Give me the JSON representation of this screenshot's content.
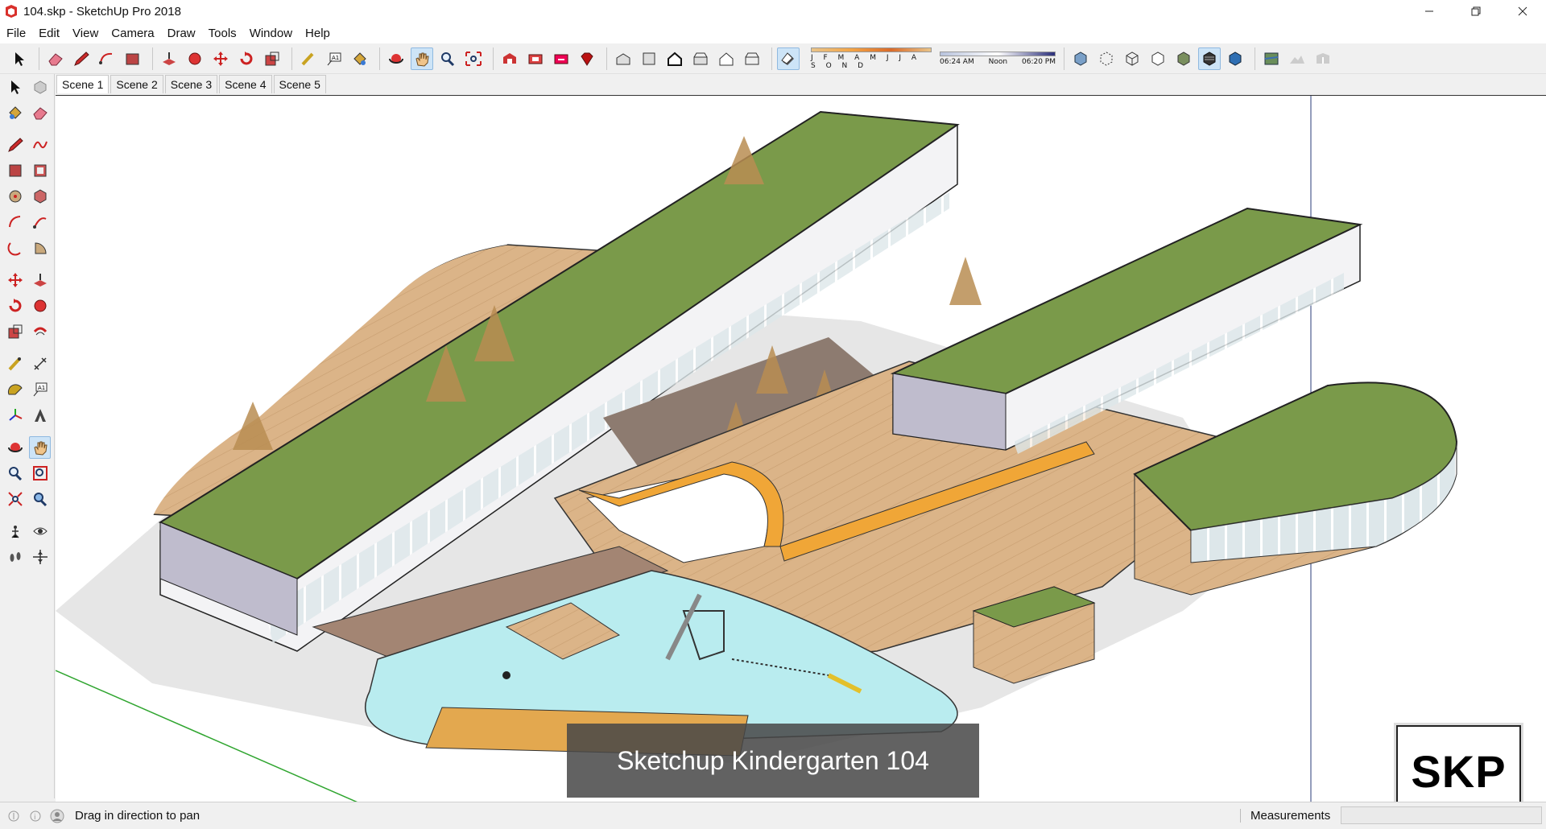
{
  "window": {
    "title": "104.skp - SketchUp Pro 2018"
  },
  "menu": [
    "File",
    "Edit",
    "View",
    "Camera",
    "Draw",
    "Tools",
    "Window",
    "Help"
  ],
  "shadow_settings": {
    "months_label": "J F M A M J J A S O N D",
    "time_start": "06:24 AM",
    "time_mid": "Noon",
    "time_end": "06:20 PM"
  },
  "scenes": [
    "Scene 1",
    "Scene 2",
    "Scene 3",
    "Scene 4",
    "Scene 5"
  ],
  "active_scene": "Scene 1",
  "viewport": {
    "caption": "Sketchup Kindergarten 104",
    "badge": "SKP"
  },
  "status": {
    "message": "Drag in direction to pan",
    "measurements_label": "Measurements",
    "measurements_value": ""
  },
  "colors": {
    "roof_green": "#7a9a4a",
    "deck_wood": "#d9b487",
    "wall_white": "#fafafa",
    "wall_shadow": "#bfbccd",
    "pool_blue": "#b9ecef",
    "accent_orange": "#f0a637",
    "axis_green": "#2fa52f"
  }
}
